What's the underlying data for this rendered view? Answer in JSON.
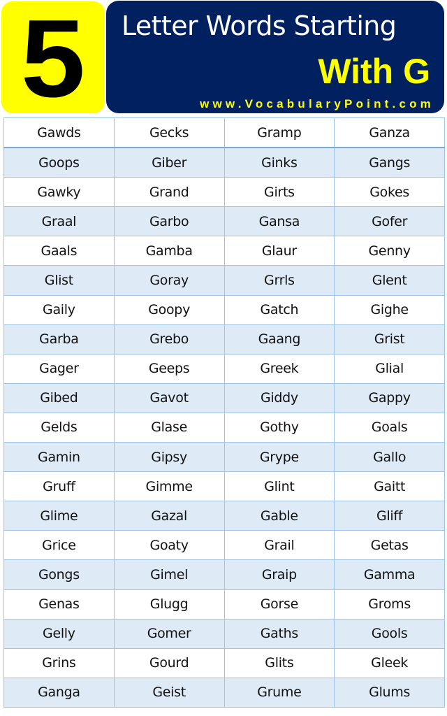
{
  "header": {
    "number": "5",
    "title_line1": "Letter Words Starting",
    "title_line2": "With G",
    "website": "www.VocabularyPoint.com",
    "colors": {
      "badge_bg": "#ffff00",
      "banner_bg": "#002060",
      "accent_text": "#ffff00",
      "title_text": "#ffffff",
      "row_alt_bg": "#deebf7",
      "grid_line": "#9dc3e6"
    }
  },
  "word_table": {
    "rows": [
      [
        "Gawds",
        "Gecks",
        "Gramp",
        "Ganza"
      ],
      [
        "Goops",
        "Giber",
        "Ginks",
        "Gangs"
      ],
      [
        "Gawky",
        "Grand",
        "Girts",
        "Gokes"
      ],
      [
        "Graal",
        "Garbo",
        "Gansa",
        "Gofer"
      ],
      [
        "Gaals",
        "Gamba",
        "Glaur",
        "Genny"
      ],
      [
        "Glist",
        "Goray",
        "Grrls",
        "Glent"
      ],
      [
        "Gaily",
        "Goopy",
        "Gatch",
        "Gighe"
      ],
      [
        "Garba",
        "Grebo",
        "Gaang",
        "Grist"
      ],
      [
        "Gager",
        "Geeps",
        "Greek",
        "Glial"
      ],
      [
        "Gibed",
        "Gavot",
        "Giddy",
        "Gappy"
      ],
      [
        "Gelds",
        "Glase",
        "Gothy",
        "Goals"
      ],
      [
        "Gamin",
        "Gipsy",
        "Grype",
        "Gallo"
      ],
      [
        "Gruff",
        "Gimme",
        "Glint",
        "Gaitt"
      ],
      [
        "Glime",
        "Gazal",
        "Gable",
        "Gliff"
      ],
      [
        "Grice",
        "Goaty",
        "Grail",
        "Getas"
      ],
      [
        "Gongs",
        "Gimel",
        "Graip",
        "Gamma"
      ],
      [
        "Genas",
        "Glugg",
        "Gorse",
        "Groms"
      ],
      [
        "Gelly",
        "Gomer",
        "Gaths",
        "Gools"
      ],
      [
        "Grins",
        "Gourd",
        "Glits",
        "Gleek"
      ],
      [
        "Ganga",
        "Geist",
        "Grume",
        "Glums"
      ]
    ]
  }
}
